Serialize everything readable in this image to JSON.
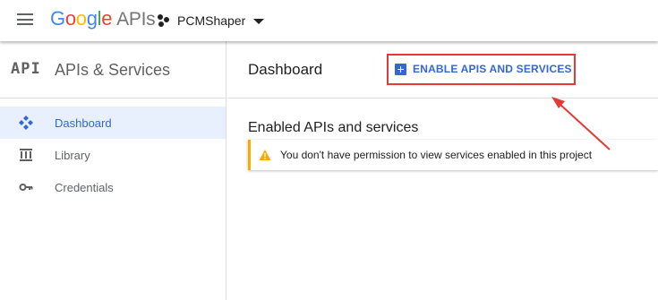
{
  "header": {
    "logo_google": [
      "G",
      "o",
      "o",
      "g",
      "l",
      "e"
    ],
    "logo_product": "APIs",
    "project_name": "PCMShaper",
    "icons": [
      "menu-icon",
      "project-icon",
      "caret-down-icon"
    ]
  },
  "sidebar": {
    "badge": "API",
    "title": "APIs & Services",
    "items": [
      {
        "label": "Dashboard",
        "icon": "dashboard-icon",
        "active": true
      },
      {
        "label": "Library",
        "icon": "library-icon",
        "active": false
      },
      {
        "label": "Credentials",
        "icon": "key-icon",
        "active": false
      }
    ]
  },
  "main": {
    "title": "Dashboard",
    "enable_button": "ENABLE APIS AND SERVICES",
    "section_title": "Enabled APIs and services",
    "warning_text": "You don't have permission to view services enabled in this project"
  },
  "colors": {
    "accent": "#3367d6",
    "highlight": "#e53935",
    "warning": "#f9ab00",
    "active_bg": "#e8f0fe"
  }
}
